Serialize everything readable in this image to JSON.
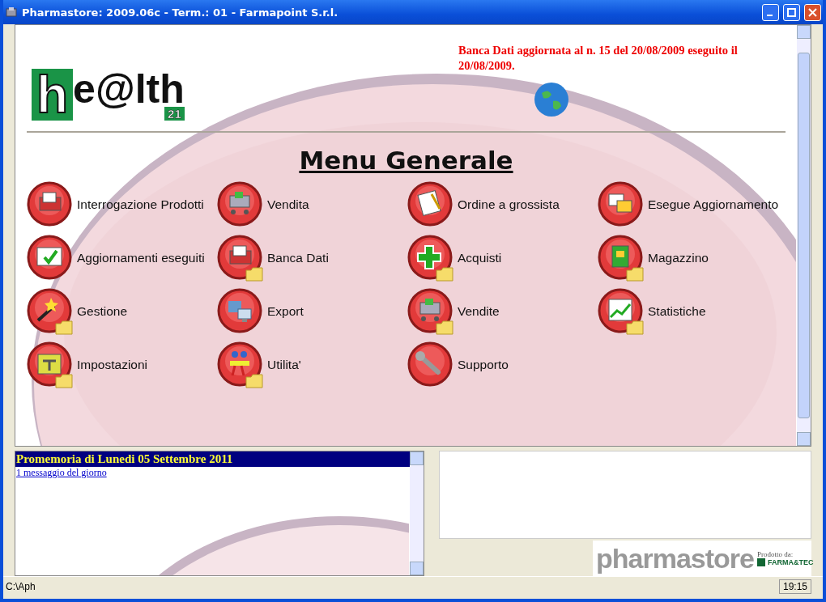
{
  "window": {
    "title": "Pharmastore: 2009.06c - Term.: 01 - Farmapoint S.r.l."
  },
  "logo": {
    "initial": "h",
    "rest": "e@lth",
    "badge": "21"
  },
  "update_notice": "Banca Dati aggiornata al n. 15 del 20/08/2009 eseguito il 20/08/2009.",
  "menu": {
    "title": "Menu Generale",
    "items": [
      {
        "label": "Interrogazione Prodotti",
        "folder": false
      },
      {
        "label": "Vendita",
        "folder": false
      },
      {
        "label": "Ordine a grossista",
        "folder": false
      },
      {
        "label": "Esegue Aggiornamento",
        "folder": false
      },
      {
        "label": "Aggiornamenti eseguiti",
        "folder": false
      },
      {
        "label": "Banca Dati",
        "folder": true
      },
      {
        "label": "Acquisti",
        "folder": true
      },
      {
        "label": "Magazzino",
        "folder": true
      },
      {
        "label": "Gestione",
        "folder": true
      },
      {
        "label": "Export",
        "folder": false
      },
      {
        "label": "Vendite",
        "folder": true
      },
      {
        "label": "Statistiche",
        "folder": true
      },
      {
        "label": "Impostazioni",
        "folder": true
      },
      {
        "label": "Utilita'",
        "folder": true
      },
      {
        "label": "Supporto",
        "folder": false
      }
    ]
  },
  "reminder": {
    "title": "Promemoria di Lunedi 05 Settembre 2011",
    "link": "1 messaggio del giorno"
  },
  "brand": {
    "name": "pharmastore",
    "maker_label": "Prodotto da:",
    "maker": "FARMA&TEC"
  },
  "status_bar": {
    "path": "C:\\Aph",
    "time": "19:15"
  }
}
